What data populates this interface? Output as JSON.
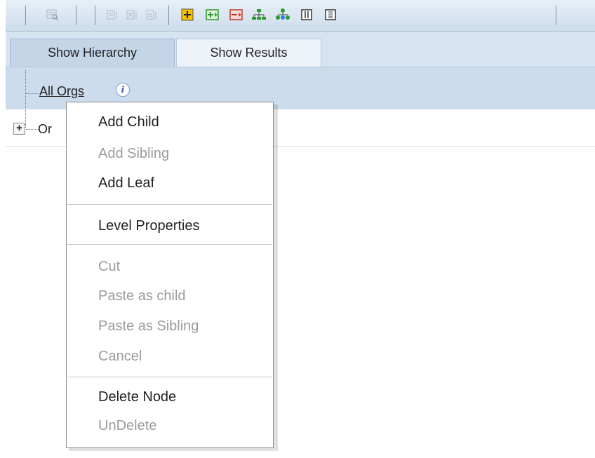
{
  "toolbar": {
    "icons": [
      {
        "name": "find-node-icon",
        "state": "disabled"
      },
      {
        "name": "move-up-icon",
        "state": "disabled"
      },
      {
        "name": "move-down-icon",
        "state": "disabled"
      },
      {
        "name": "move-node-icon",
        "state": "disabled"
      },
      {
        "name": "add-child-node-icon",
        "state": "enabled"
      },
      {
        "name": "expand-node-icon",
        "state": "enabled"
      },
      {
        "name": "collapse-node-icon",
        "state": "enabled"
      },
      {
        "name": "hierarchy-tree-icon",
        "state": "enabled"
      },
      {
        "name": "org-chart-icon",
        "state": "enabled"
      },
      {
        "name": "columns-view-icon",
        "state": "enabled"
      },
      {
        "name": "grid-view-icon",
        "state": "enabled"
      }
    ],
    "colors": {
      "accent_green": "#2e9a2e",
      "accent_red": "#c0392b",
      "accent_yellow": "#f2c200"
    }
  },
  "tabs": [
    {
      "label": "Show Hierarchy",
      "active": true
    },
    {
      "label": "Show Results",
      "active": false
    }
  ],
  "tree": {
    "root_label": "All Orgs",
    "info_glyph": "i",
    "child_label": "Or",
    "expand_glyph": "+"
  },
  "context_menu": {
    "items": [
      {
        "label": "Add Child",
        "enabled": true
      },
      {
        "label": "Add Sibling",
        "enabled": false
      },
      {
        "label": "Add Leaf",
        "enabled": true
      },
      {
        "label": "Level Properties",
        "enabled": true
      },
      {
        "label": "Cut",
        "enabled": false
      },
      {
        "label": "Paste as child",
        "enabled": false
      },
      {
        "label": "Paste as Sibling",
        "enabled": false
      },
      {
        "label": "Cancel",
        "enabled": false
      },
      {
        "label": "Delete Node",
        "enabled": true
      },
      {
        "label": "UnDelete",
        "enabled": false
      }
    ],
    "colors": {
      "enabled_text": "#222222",
      "disabled_text": "#9b9b9b"
    }
  }
}
